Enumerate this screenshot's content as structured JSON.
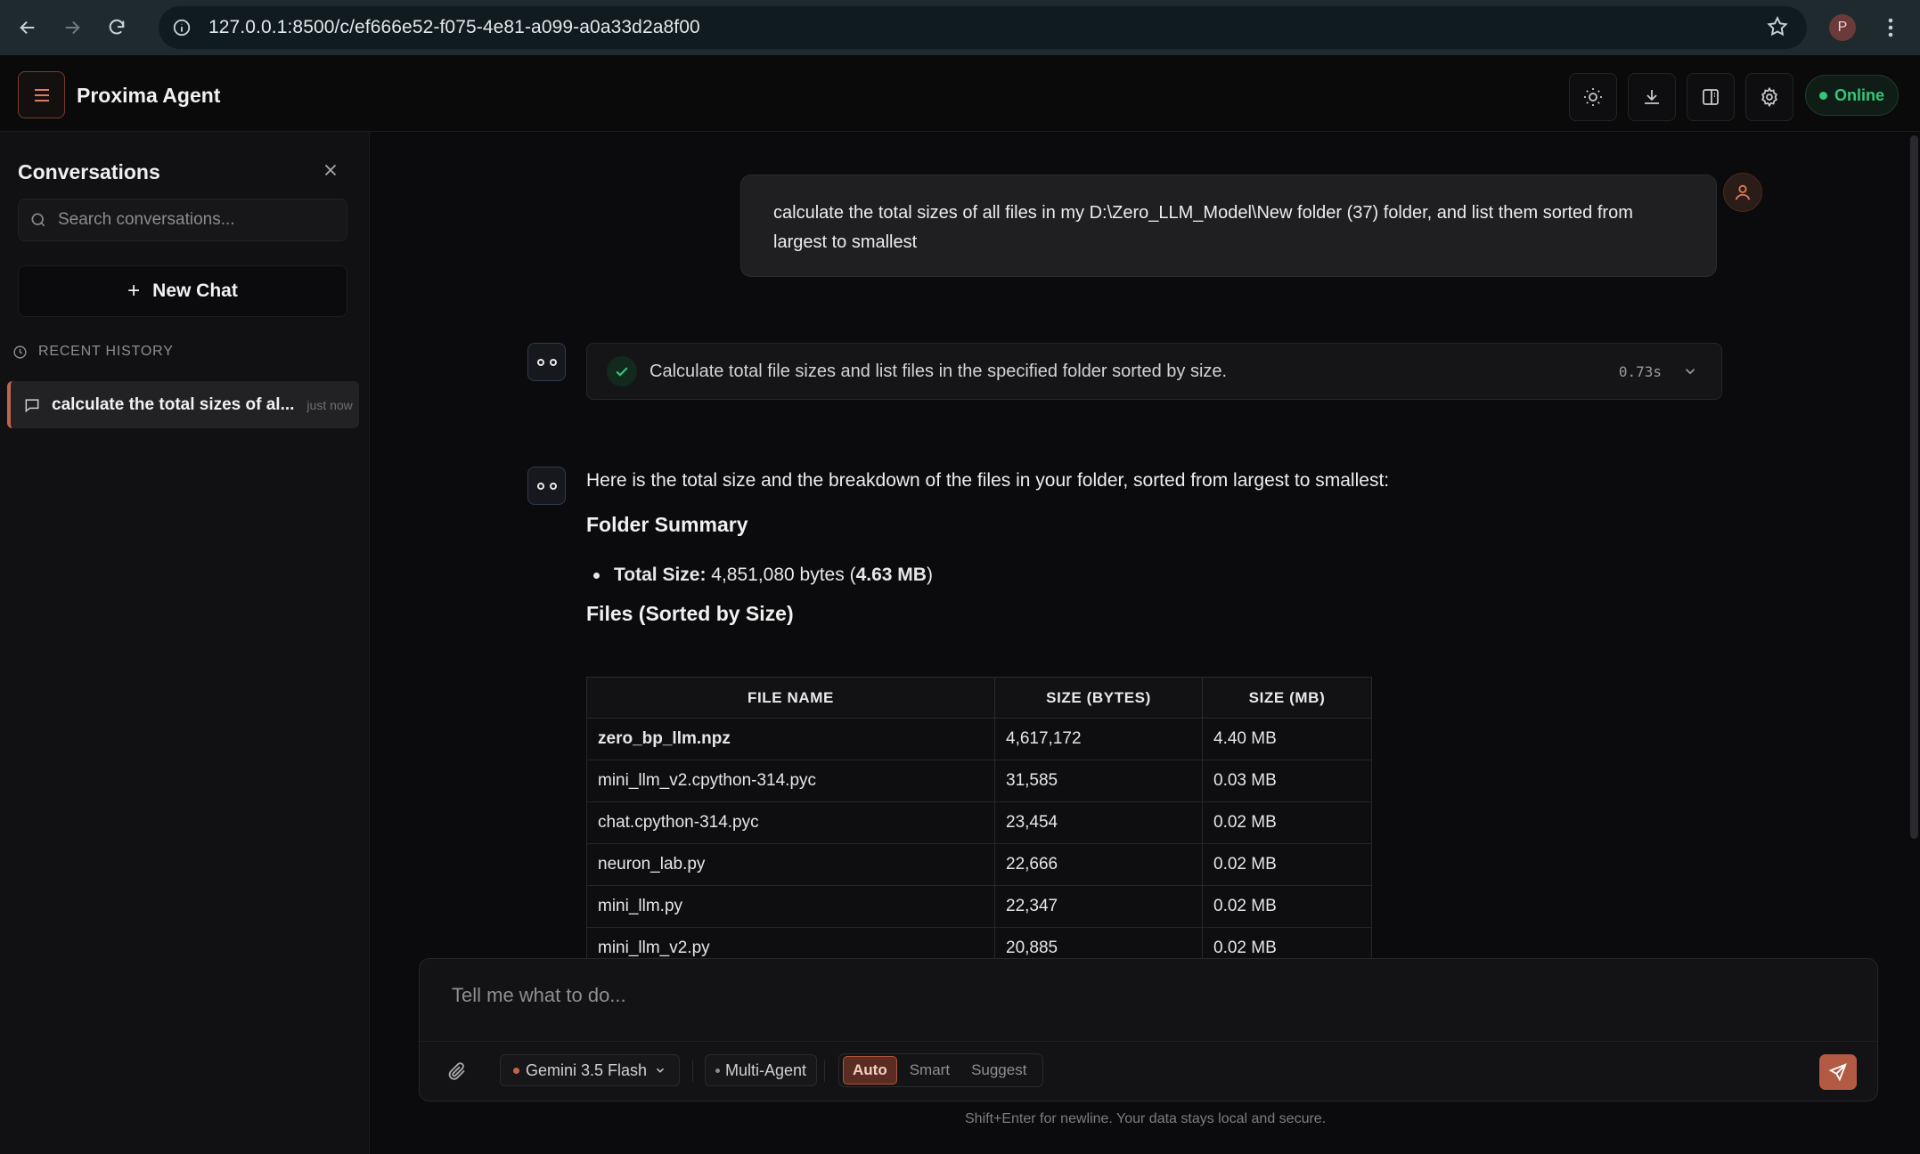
{
  "browser": {
    "url": "127.0.0.1:8500/c/ef666e52-f075-4e81-a099-a0a33d2a8f00",
    "profile_initial": "P"
  },
  "header": {
    "title": "Proxima Agent",
    "status": "Online"
  },
  "sidebar": {
    "title": "Conversations",
    "search_placeholder": "Search conversations...",
    "new_chat_label": "New Chat",
    "recent_label": "RECENT HISTORY",
    "history": [
      {
        "title": "calculate the total sizes of al...",
        "when": "just now"
      }
    ]
  },
  "chat": {
    "user_message": "calculate the total sizes of all files in my D:\\Zero_LLM_Model\\New folder (37) folder, and list them sorted from largest to smallest",
    "task": {
      "text": "Calculate total file sizes and list files in the specified folder sorted by size.",
      "time": "0.73s"
    },
    "answer": {
      "intro": "Here is the total size and the breakdown of the files in your folder, sorted from largest to smallest:",
      "summary_heading": "Folder Summary",
      "total_label": "Total Size:",
      "total_bytes": " 4,851,080 bytes (",
      "total_mb": "4.63 MB",
      "total_close": ")",
      "files_heading": "Files (Sorted by Size)",
      "columns": [
        "FILE NAME",
        "SIZE (BYTES)",
        "SIZE (MB)"
      ],
      "rows": [
        [
          "zero_bp_llm.npz",
          "4,617,172",
          "4.40 MB"
        ],
        [
          "mini_llm_v2.cpython-314.pyc",
          "31,585",
          "0.03 MB"
        ],
        [
          "chat.cpython-314.pyc",
          "23,454",
          "0.02 MB"
        ],
        [
          "neuron_lab.py",
          "22,666",
          "0.02 MB"
        ],
        [
          "mini_llm.py",
          "22,347",
          "0.02 MB"
        ],
        [
          "mini_llm_v2.py",
          "20,885",
          "0.02 MB"
        ]
      ]
    }
  },
  "composer": {
    "placeholder": "Tell me what to do...",
    "model": "Gemini 3.5 Flash",
    "multi_agent": "Multi-Agent",
    "modes": [
      "Auto",
      "Smart",
      "Suggest"
    ],
    "active_mode": "Auto",
    "footer": "Shift+Enter for newline. Your data stays local and secure."
  },
  "colors": {
    "accent": "#c0654a",
    "online": "#34c77b",
    "background": "#0b0b0d"
  }
}
